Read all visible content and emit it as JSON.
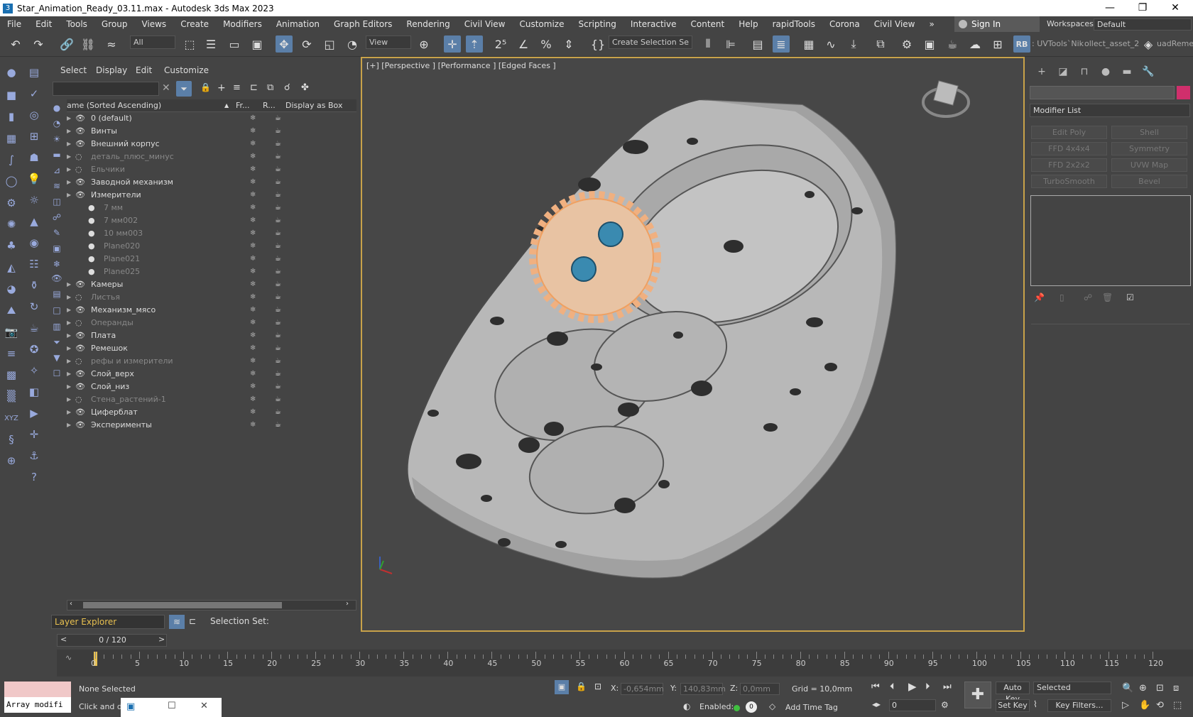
{
  "window": {
    "title": "Star_Animation_Ready_03.11.max - Autodesk 3ds Max 2023",
    "minimize": "—",
    "restore": "❐",
    "close": "✕"
  },
  "menu": [
    "File",
    "Edit",
    "Tools",
    "Group",
    "Views",
    "Create",
    "Modifiers",
    "Animation",
    "Graph Editors",
    "Rendering",
    "Civil View",
    "Customize",
    "Scripting",
    "Interactive",
    "Content",
    "Help",
    "rapidTools",
    "Corona",
    "Civil View",
    "»"
  ],
  "signin": "Sign In",
  "workspaces": {
    "label": "Workspaces:",
    "value": "Default"
  },
  "toolbar": {
    "filter": "All",
    "refcoord": "View",
    "selset": "Create Selection Se",
    "rb": "RB",
    "uvtools": ": UVTools`Nik",
    "collect": "ollect_asset_2",
    "quadremesh": "uadRemes"
  },
  "explorer": {
    "menu": [
      "Select",
      "Display",
      "Edit",
      "Customize"
    ],
    "headers": {
      "name": "ame (Sorted Ascending)",
      "frozen": "Fr...",
      "render": "R...",
      "box": "Display as Box"
    },
    "rows": [
      {
        "name": "0 (default)",
        "indent": 0,
        "eye": true,
        "dim": false
      },
      {
        "name": "Винты",
        "indent": 0,
        "eye": true,
        "dim": false
      },
      {
        "name": "Внешний корпус",
        "indent": 0,
        "eye": true,
        "dim": false
      },
      {
        "name": "деталь_плюс_минус",
        "indent": 0,
        "eye": false,
        "dim": true
      },
      {
        "name": "Ельчики",
        "indent": 0,
        "eye": false,
        "dim": true
      },
      {
        "name": "Заводной механизм",
        "indent": 0,
        "eye": true,
        "dim": false
      },
      {
        "name": "Измерители",
        "indent": 0,
        "eye": true,
        "dim": false
      },
      {
        "name": "7 мм",
        "indent": 1,
        "eye": false,
        "dim": true
      },
      {
        "name": "7 мм002",
        "indent": 1,
        "eye": false,
        "dim": true
      },
      {
        "name": "10 мм003",
        "indent": 1,
        "eye": false,
        "dim": true
      },
      {
        "name": "Plane020",
        "indent": 1,
        "eye": false,
        "dim": true
      },
      {
        "name": "Plane021",
        "indent": 1,
        "eye": false,
        "dim": true
      },
      {
        "name": "Plane025",
        "indent": 1,
        "eye": false,
        "dim": true
      },
      {
        "name": "Камеры",
        "indent": 0,
        "eye": true,
        "dim": false
      },
      {
        "name": "Листья",
        "indent": 0,
        "eye": false,
        "dim": true
      },
      {
        "name": "Механизм_мясо",
        "indent": 0,
        "eye": true,
        "dim": false
      },
      {
        "name": "Операнды",
        "indent": 0,
        "eye": false,
        "dim": true
      },
      {
        "name": "Плата",
        "indent": 0,
        "eye": true,
        "dim": false
      },
      {
        "name": "Ремешок",
        "indent": 0,
        "eye": true,
        "dim": false
      },
      {
        "name": "рефы и измерители",
        "indent": 0,
        "eye": false,
        "dim": true
      },
      {
        "name": "Слой_верх",
        "indent": 0,
        "eye": true,
        "dim": false
      },
      {
        "name": "Слой_низ",
        "indent": 0,
        "eye": true,
        "dim": false
      },
      {
        "name": "Стена_растений-1",
        "indent": 0,
        "eye": false,
        "dim": true
      },
      {
        "name": "Циферблат",
        "indent": 0,
        "eye": true,
        "dim": false
      },
      {
        "name": "Эксперименты",
        "indent": 0,
        "eye": true,
        "dim": false
      }
    ],
    "layer_explorer": "Layer Explorer",
    "selection_set": "Selection Set:"
  },
  "viewport": {
    "label": "[+] [Perspective ] [Performance ] [Edged Faces ]"
  },
  "command_panel": {
    "modifier_list": "Modifier List",
    "buttons": [
      "Edit Poly",
      "Shell",
      "FFD 4x4x4",
      "Symmetry",
      "FFD 2x2x2",
      "UVW Map",
      "TurboSmooth",
      "Bevel"
    ]
  },
  "timeline": {
    "slider": "0 / 120",
    "ticks": [
      "0",
      "5",
      "10",
      "15",
      "20",
      "25",
      "30",
      "35",
      "40",
      "45",
      "50",
      "55",
      "60",
      "65",
      "70",
      "75",
      "80",
      "85",
      "90",
      "95",
      "100",
      "105",
      "110",
      "115",
      "120"
    ]
  },
  "status": {
    "maxscript": "Array modifi",
    "selection": "None Selected",
    "prompt": "Click and dr",
    "x_label": "X:",
    "x_value": "-0,654mm",
    "y_label": "Y:",
    "y_value": "140,83mm",
    "z_label": "Z:",
    "z_value": "0,0mm",
    "grid": "Grid = 10,0mm",
    "enabled": "Enabled:",
    "add_time_tag": "Add Time Tag",
    "auto_key": "Auto Key",
    "set_key": "Set Key",
    "key_mode": "Selected",
    "key_filters": "Key Filters...",
    "frame": "0"
  },
  "colors": {
    "accent": "#5b7fa8",
    "viewport_border": "#c8a24a",
    "gear": "#f0b080",
    "object_color": "#d02f6c"
  }
}
